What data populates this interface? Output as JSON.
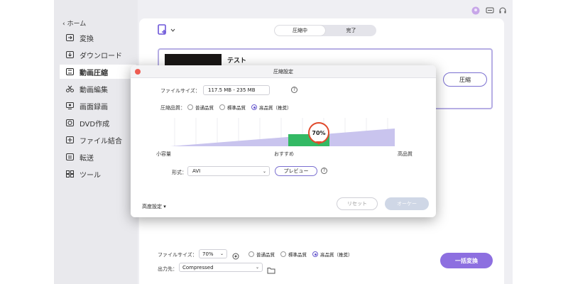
{
  "sidebar": {
    "back_label": "ホーム",
    "items": [
      {
        "label": "変換",
        "icon": "convert-icon"
      },
      {
        "label": "ダウンロード",
        "icon": "download-icon"
      },
      {
        "label": "動画圧縮",
        "icon": "compress-icon",
        "active": true
      },
      {
        "label": "動画編集",
        "icon": "scissors-icon"
      },
      {
        "label": "画面録画",
        "icon": "screen-record-icon"
      },
      {
        "label": "DVD作成",
        "icon": "disc-icon"
      },
      {
        "label": "ファイル結合",
        "icon": "merge-icon"
      },
      {
        "label": "転送",
        "icon": "transfer-icon"
      },
      {
        "label": "ツール",
        "icon": "toolbox-icon"
      }
    ]
  },
  "tabs": {
    "compressing": "圧縮中",
    "done": "完了"
  },
  "file": {
    "title": "テスト",
    "compress_label": "圧縮"
  },
  "dialog": {
    "title": "圧縮設定",
    "filesize_label": "ファイルサイズ：",
    "filesize_value": "117.5 MB - 235 MB",
    "quality_label": "圧縮品質：",
    "quality_options": [
      "普通品質",
      "標準品質",
      "高品質（推奨）"
    ],
    "quality_selected": 2,
    "slider": {
      "percent": "70%",
      "level": 0.7,
      "left_label": "小容量",
      "mid_label": "おすすめ",
      "right_label": "高品質"
    },
    "format_label": "形式：",
    "format_value": "AVI",
    "preview_label": "プレビュー",
    "advanced_label": "高度設定",
    "reset_label": "リセット",
    "ok_label": "オーケー"
  },
  "bottom": {
    "filesize_label": "ファイルサイズ：",
    "filesize_value": "70%",
    "quality_options": [
      "普通品質",
      "標準品質",
      "高品質（推奨）"
    ],
    "quality_selected": 2,
    "output_label": "出力先：",
    "output_value": "Compressed",
    "convert_all_label": "一括変換"
  },
  "colors": {
    "accent": "#8d6fe0",
    "marker": "#e0492b",
    "green": "#33b964",
    "lavender": "#c9c4ee"
  }
}
